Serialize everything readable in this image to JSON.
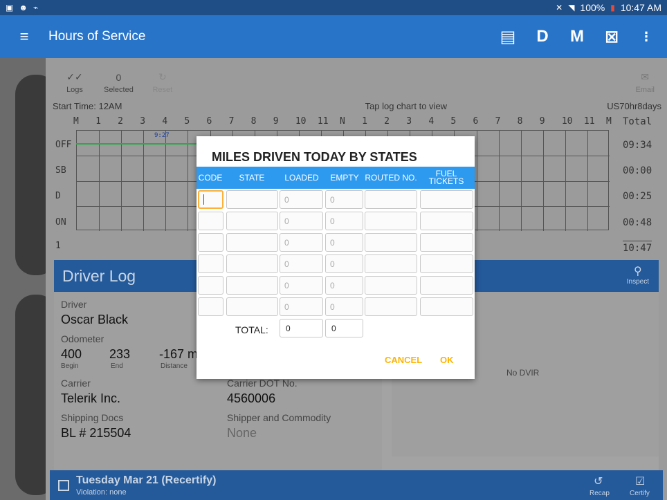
{
  "status_bar": {
    "battery": "100%",
    "time": "10:47 AM"
  },
  "app_bar": {
    "title": "Hours of Service",
    "d_label": "D",
    "m_label": "M"
  },
  "toolbar": {
    "logs_label": "Logs",
    "selected_count": "0",
    "selected_label": "Selected",
    "reset_label": "Reset",
    "email_label": "Email"
  },
  "log_chart": {
    "start_time": "Start Time: 12AM",
    "hint": "Tap log chart to view",
    "ruleset": "US70hr8days",
    "hour_labels": [
      "M",
      "1",
      "2",
      "3",
      "4",
      "5",
      "6",
      "7",
      "8",
      "9",
      "10",
      "11",
      "N",
      "1",
      "2",
      "3",
      "4",
      "5",
      "6",
      "7",
      "8",
      "9",
      "10",
      "11",
      "M"
    ],
    "total_header": "Total",
    "rows": [
      {
        "label": "OFF",
        "total": "09:34"
      },
      {
        "label": "SB",
        "total": "00:00"
      },
      {
        "label": "D",
        "total": "00:25"
      },
      {
        "label": "ON",
        "total": "00:48"
      }
    ],
    "grand_total": "10:47",
    "bottom_marker": "1",
    "event_marker": "9:27"
  },
  "driver_log": {
    "title": "Driver Log",
    "inspect_label": "Inspect",
    "driver_label": "Driver",
    "driver_value": "Oscar Black",
    "odometer_label": "Odometer",
    "odo_begin": "400",
    "odo_begin_label": "Begin",
    "odo_end": "233",
    "odo_end_label": "End",
    "odo_distance": "-167 m",
    "odo_distance_label": "Distance",
    "carrier_label": "Carrier",
    "carrier_value": "Telerik Inc.",
    "carrier_dot_label": "Carrier DOT No.",
    "carrier_dot_value": "4560006",
    "shipping_label": "Shipping Docs",
    "shipping_value": "BL # 215504",
    "shipper_label": "Shipper and Commodity",
    "shipper_value": "None",
    "no_dvir": "No DVIR"
  },
  "bottom_bar": {
    "title": "Tuesday Mar 21  (Recertify)",
    "subtitle": "Violation: none",
    "recap_label": "Recap",
    "certify_label": "Certify"
  },
  "dialog": {
    "title": "MILES DRIVEN TODAY BY STATES",
    "columns": [
      "CODE",
      "STATE",
      "LOADED",
      "EMPTY",
      "ROUTED NO.",
      "FUEL TICKETS"
    ],
    "rows": [
      {
        "loaded_placeholder": "0",
        "empty_placeholder": "0"
      },
      {
        "loaded_placeholder": "0",
        "empty_placeholder": "0"
      },
      {
        "loaded_placeholder": "0",
        "empty_placeholder": "0"
      },
      {
        "loaded_placeholder": "0",
        "empty_placeholder": "0"
      },
      {
        "loaded_placeholder": "0",
        "empty_placeholder": "0"
      },
      {
        "loaded_placeholder": "0",
        "empty_placeholder": "0"
      }
    ],
    "total_label": "TOTAL:",
    "total_loaded": "0",
    "total_empty": "0",
    "cancel_label": "CANCEL",
    "ok_label": "OK"
  }
}
